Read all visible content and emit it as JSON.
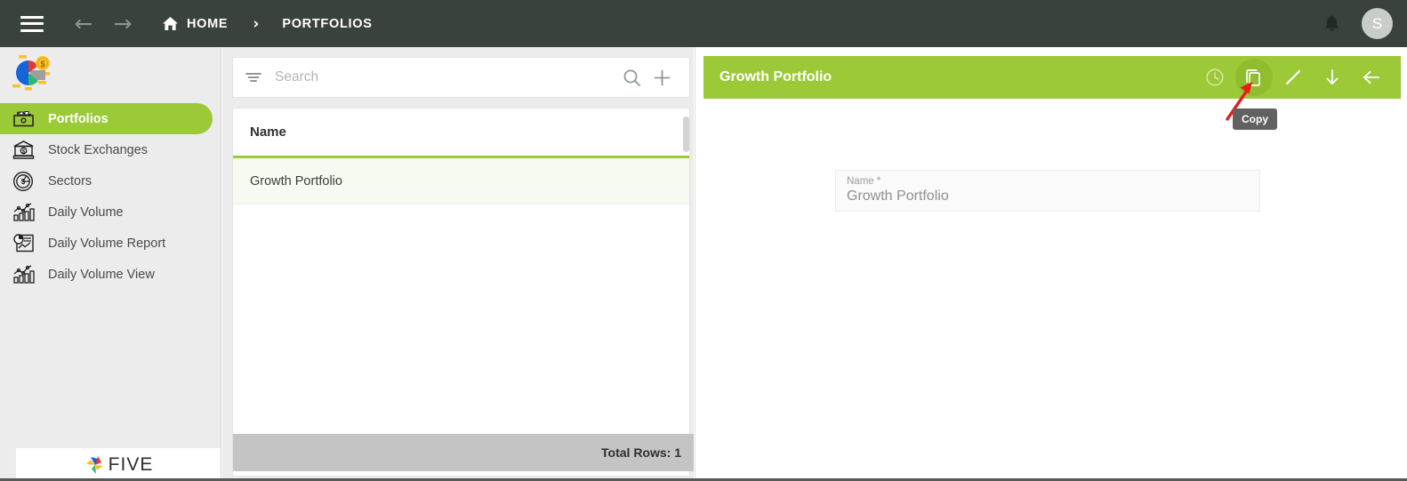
{
  "topbar": {
    "menu_icon": "hamburger-icon",
    "back_arrow": "←",
    "forward_arrow": "→",
    "home_label": "HOME",
    "separator": "›",
    "current_label": "PORTFOLIOS",
    "bell_icon": "notification-bell-icon",
    "avatar_initial": "S"
  },
  "sidebar": {
    "logo_icon": "pie-chart-coin-logo",
    "items": [
      {
        "label": "Portfolios",
        "icon": "portfolio-folder-icon",
        "active": true
      },
      {
        "label": "Stock Exchanges",
        "icon": "bank-icon",
        "active": false
      },
      {
        "label": "Sectors",
        "icon": "pie-chart-dollar-icon",
        "active": false
      },
      {
        "label": "Daily Volume",
        "icon": "bar-chart-line-icon",
        "active": false
      },
      {
        "label": "Daily Volume Report",
        "icon": "report-document-icon",
        "active": false
      },
      {
        "label": "Daily Volume View",
        "icon": "bar-chart-line-icon",
        "active": false
      }
    ],
    "footer_brand": "FIVE"
  },
  "list_panel": {
    "search": {
      "placeholder": "Search",
      "value": "",
      "filter_icon": "filter-icon",
      "search_icon": "search-icon",
      "add_icon": "plus-icon"
    },
    "table": {
      "columns": [
        "Name"
      ],
      "rows": [
        {
          "name": "Growth Portfolio",
          "selected": true
        }
      ]
    },
    "totals_label": "Total Rows: 1"
  },
  "detail_panel": {
    "title": "Growth Portfolio",
    "actions": [
      {
        "name": "history-clock-icon",
        "label": "History",
        "state": "dim"
      },
      {
        "name": "copy-icon",
        "label": "Copy",
        "state": "hovered"
      },
      {
        "name": "edit-pencil-icon",
        "label": "Edit",
        "state": "normal"
      },
      {
        "name": "download-arrow-icon",
        "label": "Download",
        "state": "normal"
      },
      {
        "name": "back-arrow-icon",
        "label": "Back",
        "state": "normal"
      }
    ],
    "fields": [
      {
        "label": "Name *",
        "value": "Growth Portfolio"
      }
    ]
  },
  "tooltip": {
    "text": "Copy"
  },
  "colors": {
    "topbar": "#3a423e",
    "accent_green": "#9cc938",
    "sidebar_bg": "#ececec",
    "row_selected": "#f6faf0",
    "totals_bar": "#c4c4c4",
    "tooltip_bg": "#616161",
    "annotation_arrow": "#e81c1c"
  }
}
